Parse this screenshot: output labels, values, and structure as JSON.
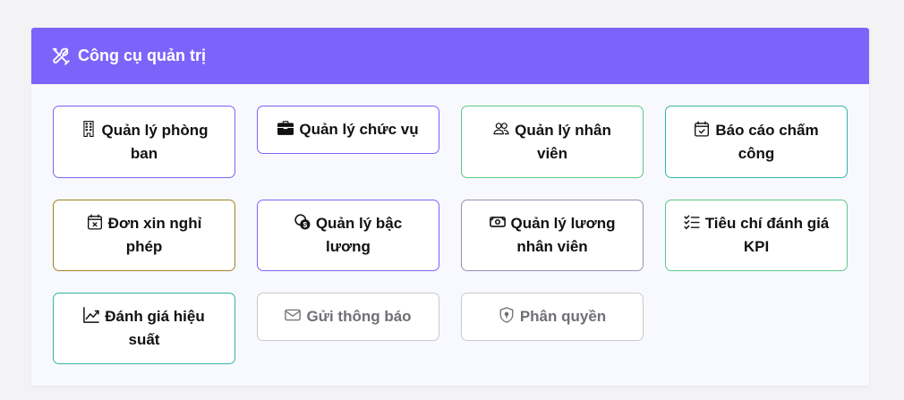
{
  "header": {
    "title": "Công cụ quản trị",
    "icon": "tools-icon",
    "background": "#7c64fa"
  },
  "tools": [
    {
      "label": "Quản lý phòng ban",
      "icon": "building-icon",
      "border": "#7c64fa",
      "disabled": false
    },
    {
      "label": "Quản lý chức vụ",
      "icon": "briefcase-icon",
      "border": "#7c64fa",
      "disabled": false
    },
    {
      "label": "Quản lý nhân viên",
      "icon": "people-icon",
      "border": "#5cc98a",
      "disabled": false
    },
    {
      "label": "Báo cáo chấm công",
      "icon": "calendar-check-icon",
      "border": "#34b3a8",
      "disabled": false
    },
    {
      "label": "Đơn xin nghỉ phép",
      "icon": "calendar-x-icon",
      "border": "#a08420",
      "disabled": false
    },
    {
      "label": "Quản lý bậc lương",
      "icon": "coins-icon",
      "border": "#7c64fa",
      "disabled": false
    },
    {
      "label": "Quản lý lương nhân viên",
      "icon": "cash-icon",
      "border": "#9a8fb5",
      "disabled": false
    },
    {
      "label": "Tiêu chí đánh giá KPI",
      "icon": "list-check-icon",
      "border": "#5cc98a",
      "disabled": false
    },
    {
      "label": "Đánh giá hiệu suất",
      "icon": "graph-up-icon",
      "border": "#34b3a8",
      "disabled": false
    },
    {
      "label": "Gửi thông báo",
      "icon": "envelope-icon",
      "border": "#c8c8cc",
      "disabled": true
    },
    {
      "label": "Phân quyền",
      "icon": "shield-lock-icon",
      "border": "#c8c8cc",
      "disabled": true
    }
  ]
}
